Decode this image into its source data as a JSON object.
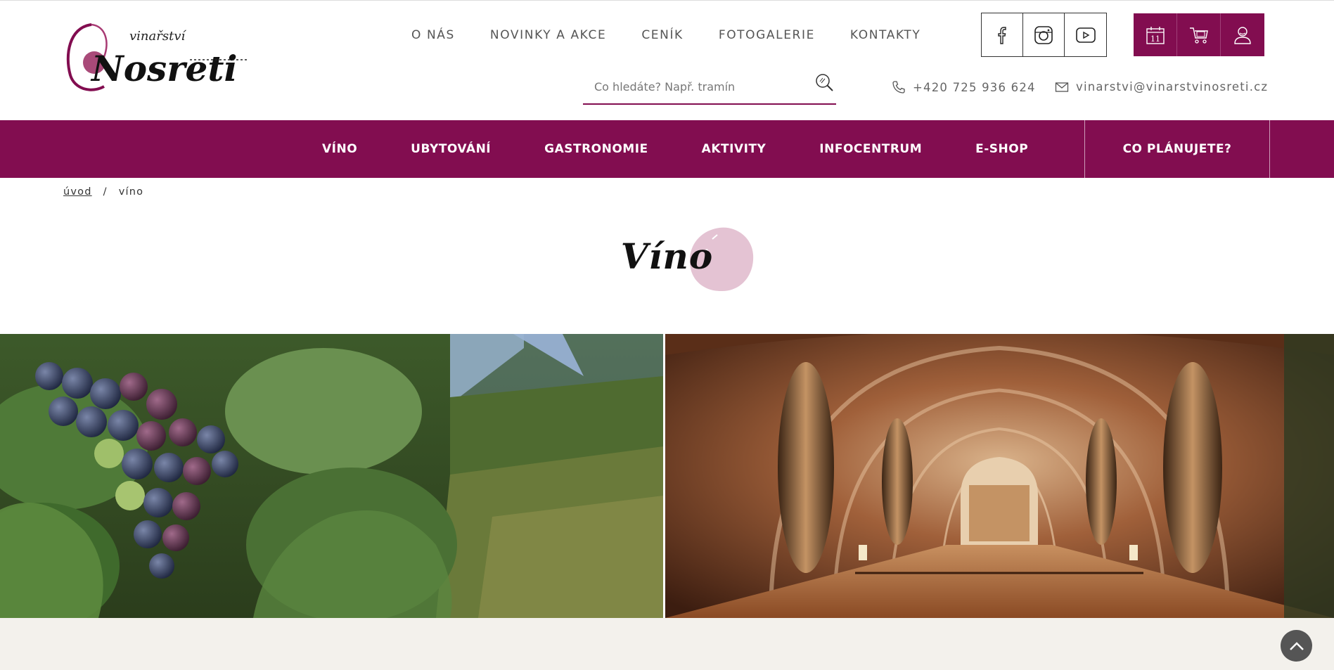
{
  "brand": {
    "logo_small_text": "vinařství",
    "logo_main_text": "Nosreti",
    "accent_color": "#820d50"
  },
  "top_nav": {
    "items": [
      "O NÁS",
      "NOVINKY A AKCE",
      "CENÍK",
      "FOTOGALERIE",
      "KONTAKTY"
    ]
  },
  "social": {
    "icons": [
      "facebook-icon",
      "instagram-icon",
      "youtube-icon"
    ]
  },
  "quick_actions": {
    "icons": [
      "calendar-icon",
      "cart-icon",
      "user-icon"
    ],
    "calendar_day": "11"
  },
  "search": {
    "placeholder": "Co hledáte? Např. tramín"
  },
  "contact": {
    "phone": "+420 725 936 624",
    "email": "vinarstvi@vinarstvinosreti.cz"
  },
  "main_nav": {
    "items": [
      "VÍNO",
      "UBYTOVÁNÍ",
      "GASTRONOMIE",
      "AKTIVITY",
      "INFOCENTRUM",
      "E-SHOP"
    ],
    "plan_label": "CO PLÁNUJETE?"
  },
  "breadcrumb": {
    "home": "úvod",
    "separator": "/",
    "current": "víno"
  },
  "page": {
    "title": "Víno"
  },
  "images": {
    "left": "grapes-vineyard-image",
    "right": "wine-cellar-image"
  }
}
